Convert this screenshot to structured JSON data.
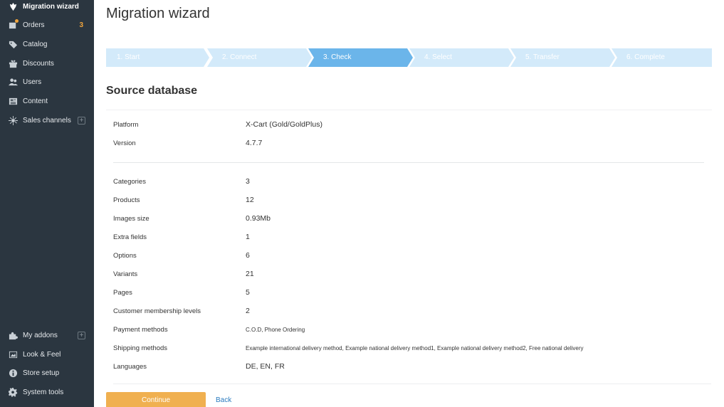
{
  "sidebar": {
    "items": [
      {
        "label": "Migration wizard",
        "icon": "migration-icon"
      },
      {
        "label": "Orders",
        "icon": "orders-icon",
        "badge": "3"
      },
      {
        "label": "Catalog",
        "icon": "catalog-icon"
      },
      {
        "label": "Discounts",
        "icon": "discounts-icon"
      },
      {
        "label": "Users",
        "icon": "users-icon"
      },
      {
        "label": "Content",
        "icon": "content-icon"
      },
      {
        "label": "Sales channels",
        "icon": "sales-channels-icon",
        "plus": "+"
      },
      {
        "label": "My addons",
        "icon": "addons-icon",
        "plus": "+"
      },
      {
        "label": "Look & Feel",
        "icon": "look-feel-icon"
      },
      {
        "label": "Store setup",
        "icon": "store-setup-icon"
      },
      {
        "label": "System tools",
        "icon": "system-tools-icon"
      }
    ]
  },
  "header": {
    "title": "Migration wizard"
  },
  "steps": [
    {
      "label": "1. Start",
      "state": "done"
    },
    {
      "label": "2. Connect",
      "state": "done"
    },
    {
      "label": "3. Check",
      "state": "active"
    },
    {
      "label": "4. Select",
      "state": "pending"
    },
    {
      "label": "5. Transfer",
      "state": "pending"
    },
    {
      "label": "6. Complete",
      "state": "pending"
    }
  ],
  "source": {
    "title": "Source database",
    "platform_label": "Platform",
    "platform_value": "X-Cart (Gold/GoldPlus)",
    "version_label": "Version",
    "version_value": "4.7.7",
    "stats": [
      {
        "label": "Categories",
        "value": "3"
      },
      {
        "label": "Products",
        "value": "12"
      },
      {
        "label": "Images size",
        "value": "0.93Mb"
      },
      {
        "label": "Extra fields",
        "value": "1"
      },
      {
        "label": "Options",
        "value": "6"
      },
      {
        "label": "Variants",
        "value": "21"
      },
      {
        "label": "Pages",
        "value": "5"
      },
      {
        "label": "Customer membership levels",
        "value": "2"
      },
      {
        "label": "Payment methods",
        "value": "C.O.D, Phone Ordering"
      },
      {
        "label": "Shipping methods",
        "value": "Example international delivery method, Example national delivery method1, Example national delivery method2, Free national delivery"
      },
      {
        "label": "Languages",
        "value": "DE, EN, FR"
      }
    ]
  },
  "actions": {
    "continue_label": "Continue",
    "back_label": "Back"
  },
  "colors": {
    "sidebar_bg": "#2b3640",
    "step_active": "#6bb5ea",
    "step_inactive": "#d3eafa",
    "continue_button": "#f0b050",
    "link": "#2a7bbf",
    "badge": "#f0a43c"
  }
}
